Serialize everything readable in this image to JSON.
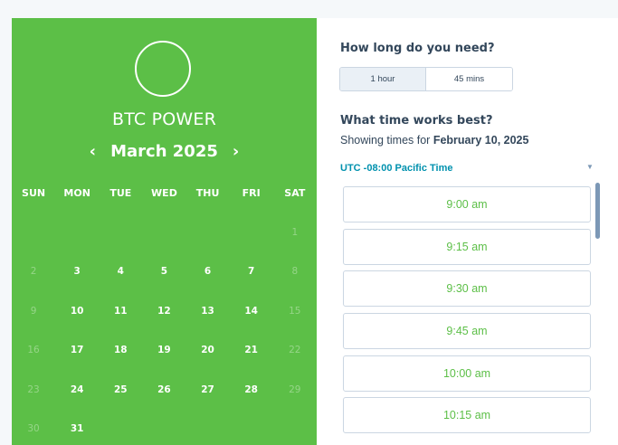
{
  "calendar": {
    "company": "BTC POWER",
    "month_label": "March 2025",
    "prev_arrow": "‹",
    "next_arrow": "›",
    "weekdays": [
      "SUN",
      "MON",
      "TUE",
      "WED",
      "THU",
      "FRI",
      "SAT"
    ],
    "weeks": [
      [
        {
          "d": ""
        },
        {
          "d": ""
        },
        {
          "d": ""
        },
        {
          "d": ""
        },
        {
          "d": ""
        },
        {
          "d": ""
        },
        {
          "d": "1",
          "muted": true
        }
      ],
      [
        {
          "d": "2",
          "muted": true
        },
        {
          "d": "3"
        },
        {
          "d": "4"
        },
        {
          "d": "5"
        },
        {
          "d": "6"
        },
        {
          "d": "7"
        },
        {
          "d": "8",
          "muted": true
        }
      ],
      [
        {
          "d": "9",
          "muted": true
        },
        {
          "d": "10"
        },
        {
          "d": "11"
        },
        {
          "d": "12"
        },
        {
          "d": "13"
        },
        {
          "d": "14"
        },
        {
          "d": "15",
          "muted": true
        }
      ],
      [
        {
          "d": "16",
          "muted": true
        },
        {
          "d": "17"
        },
        {
          "d": "18"
        },
        {
          "d": "19"
        },
        {
          "d": "20"
        },
        {
          "d": "21"
        },
        {
          "d": "22",
          "muted": true
        }
      ],
      [
        {
          "d": "23",
          "muted": true
        },
        {
          "d": "24"
        },
        {
          "d": "25"
        },
        {
          "d": "26"
        },
        {
          "d": "27"
        },
        {
          "d": "28"
        },
        {
          "d": "29",
          "muted": true
        }
      ],
      [
        {
          "d": "30",
          "muted": true
        },
        {
          "d": "31"
        },
        {
          "d": ""
        },
        {
          "d": ""
        },
        {
          "d": ""
        },
        {
          "d": ""
        },
        {
          "d": ""
        }
      ]
    ],
    "accent_color": "#5cbf47"
  },
  "panel": {
    "duration_question": "How long do you need?",
    "durations": [
      "1 hour",
      "45 mins"
    ],
    "selected_duration": "1 hour",
    "time_question": "What time works best?",
    "showing_prefix": "Showing times for ",
    "showing_date": "February 10, 2025",
    "timezone": "UTC -08:00 Pacific Time",
    "timezone_caret": "▼",
    "time_slots": [
      "9:00 am",
      "9:15 am",
      "9:30 am",
      "9:45 am",
      "10:00 am",
      "10:15 am"
    ],
    "link_color": "#0091ae"
  }
}
